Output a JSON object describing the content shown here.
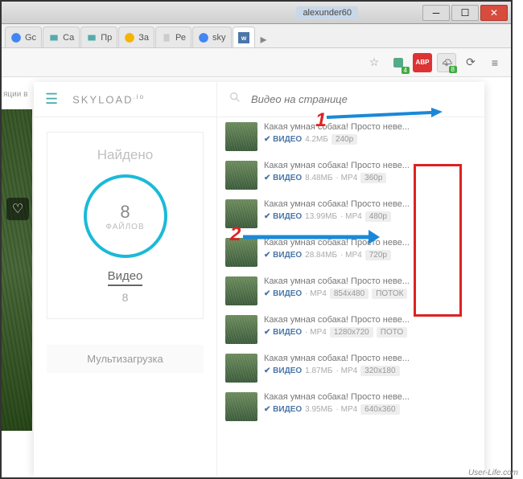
{
  "window": {
    "user": "alexunder60"
  },
  "tabs": [
    {
      "label": "Gc",
      "favicon": "google"
    },
    {
      "label": "Са",
      "favicon": "site"
    },
    {
      "label": "Пр",
      "favicon": "site"
    },
    {
      "label": "За",
      "favicon": "chrome"
    },
    {
      "label": "Ре",
      "favicon": "page"
    },
    {
      "label": "sky",
      "favicon": "google"
    },
    {
      "label": "",
      "favicon": "vk",
      "active": true
    }
  ],
  "annotations": {
    "label1": "1",
    "label2": "2"
  },
  "watermark": "User-Life.com",
  "extensions": {
    "abp": "ABP",
    "skyload_badge": "8"
  },
  "popup": {
    "title": "SKYLOAD",
    "title_sup": ".io",
    "found": "Найдено",
    "count": "8",
    "count_label": "ФАЙЛОВ",
    "video": "Видео",
    "video_count": "8",
    "multi": "Мультизагрузка",
    "search_placeholder": "Видео на странице"
  },
  "files": [
    {
      "title": "Какая умная собака! Просто неве...",
      "source": "ВИДЕО",
      "size": "4.2МБ",
      "fmt": "",
      "quality": "240p"
    },
    {
      "title": "Какая умная собака! Просто неве...",
      "source": "ВИДЕО",
      "size": "8.48МБ",
      "fmt": "MP4",
      "quality": "360p"
    },
    {
      "title": "Какая умная собака! Просто неве...",
      "source": "ВИДЕО",
      "size": "13.99МБ",
      "fmt": "MP4",
      "quality": "480p"
    },
    {
      "title": "Какая умная собака! Просто неве...",
      "source": "ВИДЕО",
      "size": "28.84МБ",
      "fmt": "MP4",
      "quality": "720p"
    },
    {
      "title": "Какая умная собака! Просто неве...",
      "source": "ВИДЕО",
      "size": "",
      "fmt": "MP4",
      "quality": "854x480",
      "extra": "ПОТОК"
    },
    {
      "title": "Какая умная собака! Просто неве...",
      "source": "ВИДЕО",
      "size": "",
      "fmt": "MP4",
      "quality": "1280x720",
      "extra": "ПОТО"
    },
    {
      "title": "Какая умная собака! Просто неве...",
      "source": "ВИДЕО",
      "size": "1.87МБ",
      "fmt": "MP4",
      "quality": "320x180"
    },
    {
      "title": "Какая умная собака! Просто неве...",
      "source": "ВИДЕО",
      "size": "3.95МБ",
      "fmt": "MP4",
      "quality": "640x360"
    }
  ]
}
